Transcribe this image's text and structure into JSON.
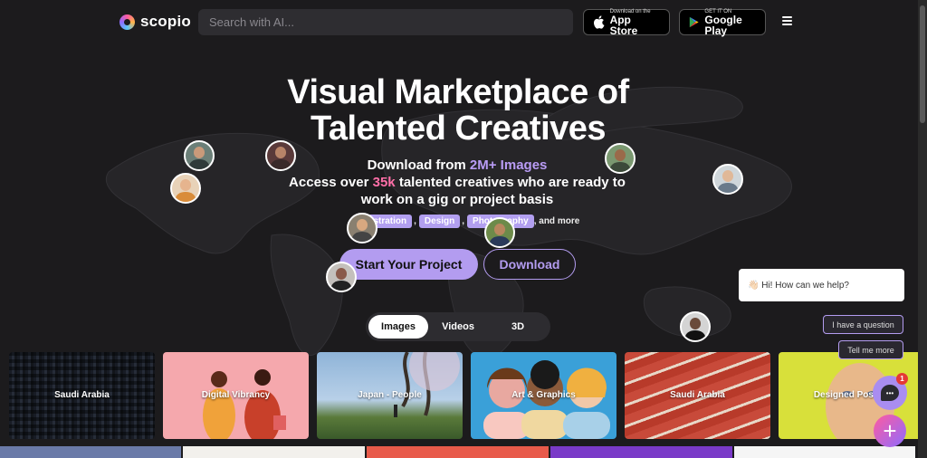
{
  "header": {
    "brand": "scopio",
    "search_placeholder": "Search with AI...",
    "app_store": {
      "small": "Download on the",
      "big": "App Store"
    },
    "google_play": {
      "small": "GET IT ON",
      "big": "Google Play"
    },
    "menu_icon": "hamburger-icon"
  },
  "hero": {
    "title_line1": "Visual Marketplace of",
    "title_line2": "Talented Creatives",
    "line1_prefix": "Download from ",
    "line1_highlight": "2M+ Images",
    "line2_prefix": "Access over ",
    "line2_highlight": "35k",
    "line2_suffix": " talented creatives who are ready to",
    "line3": "work on a gig or project basis",
    "tags": [
      "Illustration",
      "Design",
      "Photography"
    ],
    "tags_suffix": ", and more",
    "primary_button": "Start Your Project",
    "secondary_button": "Download"
  },
  "media_tabs": [
    {
      "label": "Images",
      "active": true
    },
    {
      "label": "Videos",
      "active": false
    },
    {
      "label": "3D",
      "active": false
    }
  ],
  "cards": [
    {
      "label": "Saudi Arabia"
    },
    {
      "label": "Digital Vibrancy"
    },
    {
      "label": "Japan - People"
    },
    {
      "label": "Art & Graphics"
    },
    {
      "label": "Saudi Arabia"
    },
    {
      "label": "Designed Possibi"
    }
  ],
  "chat": {
    "greeting": "👋🏻 Hi! How can we help?",
    "quick_replies": [
      "I have a question",
      "Tell me more"
    ],
    "badge_count": "1",
    "fab_symbol": "+"
  },
  "colors": {
    "background": "#1c1b1d",
    "accent_purple": "#b39cf0",
    "accent_pink": "#ff6fa8"
  }
}
